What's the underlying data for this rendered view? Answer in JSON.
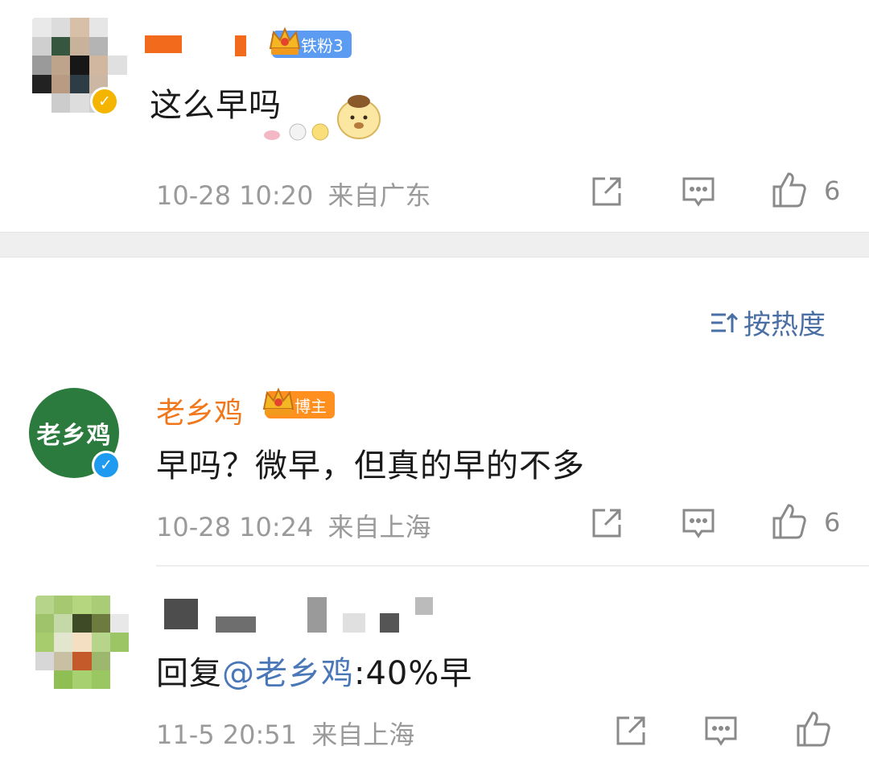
{
  "comments": [
    {
      "badge": "铁粉3",
      "text": "这么早吗",
      "date": "10-28 10:20",
      "location": "来自广东",
      "likes": "6"
    },
    {
      "username": "老乡鸡",
      "avatar_text": "老乡鸡",
      "badge": "博主",
      "text": "早吗？微早，但真的早的不多",
      "date": "10-28 10:24",
      "location": "来自上海",
      "likes": "6"
    },
    {
      "reply_prefix": "回复",
      "mention": "@老乡鸡",
      "reply_text": ":40%早",
      "date": "11-5 20:51",
      "location": "来自上海",
      "likes": ""
    }
  ],
  "sort": {
    "label": "按热度"
  },
  "icons": {
    "share": "share-icon",
    "comment": "comment-icon",
    "like": "like-icon",
    "sort": "sort-icon",
    "verified": "verified-icon",
    "crown": "crown-icon"
  },
  "colors": {
    "username": "#f0771b",
    "mention": "#4a77b8",
    "fan_badge": "#5b9cf2",
    "host_badge": "#ff8f1f",
    "meta": "#9a9a9a"
  }
}
